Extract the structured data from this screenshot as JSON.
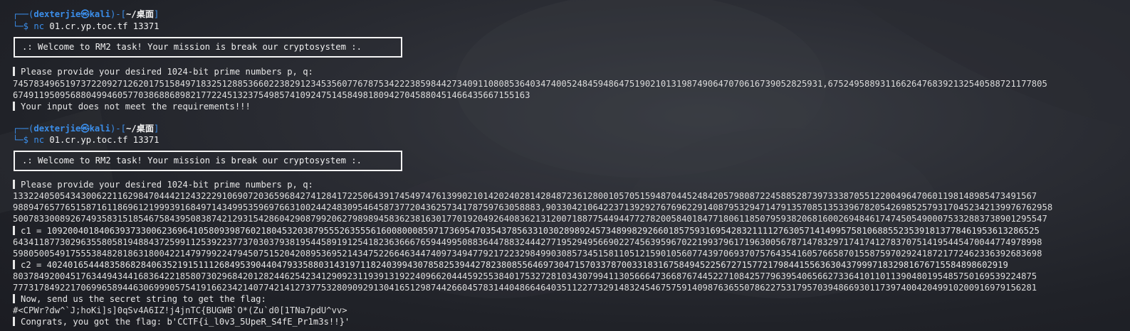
{
  "session1": {
    "prompt": {
      "corner_top": "┌──(",
      "user": "dexterjie㉿kali",
      "mid": ")-[",
      "path": "~/桌面",
      "close": "]",
      "corner_bottom": "└─$ ",
      "command": "nc 01.cr.yp.toc.tf 13371"
    },
    "welcome": ".: Welcome to RM2 task! Your mission is break our cryptosystem :.",
    "ask": "Please provide your desired 1024-bit prime numbers p, q:",
    "input_line1": "74578349651973722092712620175158497183251288536602238291234535607767875342223859844273409110808536403474005248459486475190210131987490647070616739052825931,675249588931166264768392132540588721177805",
    "input_line2": "674911950956880499460577038688689821772245132375498574109247514584981809427045880451466435667155163",
    "error": "Your input does not meet the requirements!!!"
  },
  "session2": {
    "prompt": {
      "corner_top": "┌──(",
      "user": "dexterjie㉿kali",
      "mid": ")-[",
      "path": "~/桌面",
      "close": "]",
      "corner_bottom": "└─$ ",
      "command": "nc 01.cr.yp.toc.tf 13371"
    },
    "welcome": ".: Welcome to RM2 task! Your mission is break our cryptosystem :.",
    "ask": "Please provide your desired 1024-bit prime numbers p, q:",
    "input_line1": "1332240505434300622116298470444212432229106907203659684274128417225064391745497476139902101420240281428487236128001057051594870445248420579808722458852873973338705512200496470601198148985473491567",
    "input_line2": "98894765776515871611869612199939168497143499535969766310024424830954645873772043625734178759763058883,9033042106422371392927676962291408795329471479135708513533967820542698525793170452342139976762958",
    "input_line3": "500783300892674935831518546758439508387421293154286042908799206279898945836238163017701920492640836213120071887754494477278200584018477180611850795938206816002694846174745054900075332883738901295547",
    "c1_line1": "c1 = 1092004018406393733006236964105809398760218045320387955526355561600800085971736954703543785633103028989245734899829266018575931695428321111276305714149957581068855235391813778461953613286525",
    "c1_line2": "64341187730296355805819488437259911253922377370303793819544589191254182363666765944995088364478832444277195294956690227456395967022199379617196300567871478329717417412783707514195445470044774978998",
    "c1_line3": "59805005491755538482818631800422147979922479450751520420895369521434752266463447409734947792172232984990308573451581105121590105607743970693707576435416057665870155875970292418721772462336392683698",
    "c2_line1": "c2 = 4024016544483586828406352191511126849539044047933588031431971182403994307858253944278238085564697304715703378700331831675849452256727157721798441556363043799971832981676715584898602919",
    "c2_line2": "8037849200451763449434416836422185807302968420128244625423412909231193913192240966204445925538401753272810343079941130566647366876744522710842577963954065662733641011011390480195485750169539224875",
    "c2_line3": "7773178492217069965894463069990575419166234214077421412737753280909291304165129874426604578314404866464035112277329148324546757591409876365507862275317957039486693011739740042049910200916979156281",
    "now": "Now, send us the secret string to get the flag:",
    "secret": "#<CPWr?dw^`J;hoKi]s]0qSv4A6IZ!j4jnTC{BUGWB`O*(Zu`d0[1TNa7pdU^vv>",
    "flag": "Congrats, you got the flag: b'CCTF{i_l0v3_5UpeR_S4fE_Pr1m3s!!}'"
  },
  "colors": {
    "prompt_blue": "#3b8eea",
    "text": "#e6e6e6",
    "background": "#25272d"
  }
}
